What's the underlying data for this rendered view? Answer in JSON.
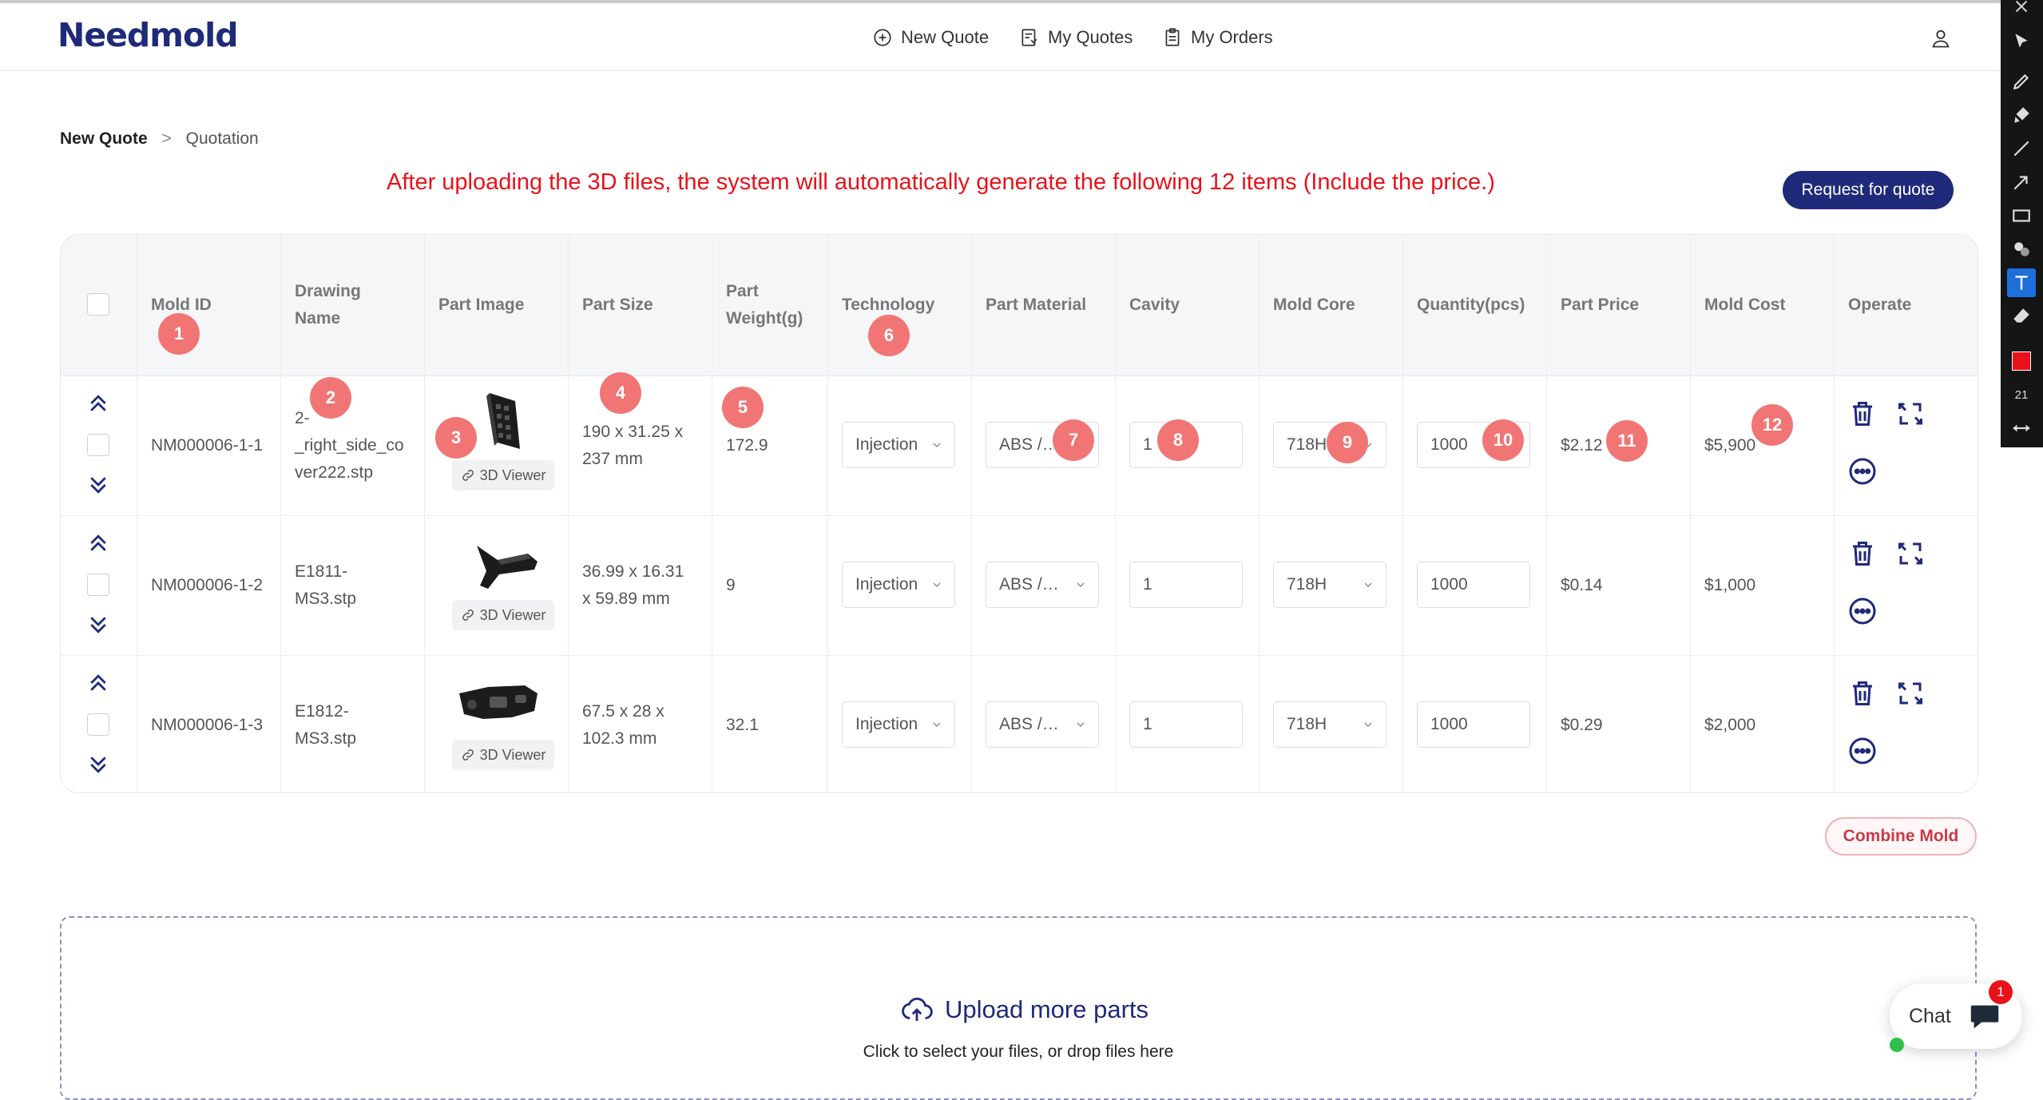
{
  "brand": {
    "logo_text": "Needmold",
    "accent": "#1f2a7a"
  },
  "nav": {
    "new_quote": "New Quote",
    "my_quotes": "My Quotes",
    "my_orders": "My Orders"
  },
  "breadcrumb": {
    "root": "New Quote",
    "separator": ">",
    "current": "Quotation"
  },
  "annotation_text": "After uploading the 3D files, the system will automatically generate the following 12 items (Include the price.)",
  "request_button": "Request for quote",
  "table": {
    "headers": {
      "mold_id": "Mold ID",
      "drawing_name_1": "Drawing",
      "drawing_name_2": "Name",
      "part_image": "Part Image",
      "part_size": "Part Size",
      "part_weight_1": "Part",
      "part_weight_2": "Weight(g)",
      "technology": "Technology",
      "part_material": "Part Material",
      "cavity": "Cavity",
      "mold_core": "Mold Core",
      "quantity": "Quantity(pcs)",
      "part_price": "Part Price",
      "mold_cost": "Mold Cost",
      "operate": "Operate"
    },
    "rows": [
      {
        "mold_id": "NM000006-1-1",
        "drawing_1": "2-",
        "drawing_2": "_right_side_co",
        "drawing_3": "ver222.stp",
        "size_1": "190 x 31.25 x",
        "size_2": "237 mm",
        "weight": "172.9",
        "technology": "Injection",
        "material": "ABS /…",
        "cavity": "1",
        "core": "718H",
        "quantity": "1000",
        "part_price": "$2.12",
        "mold_cost": "$5,900",
        "viewer": "3D Viewer"
      },
      {
        "mold_id": "NM000006-1-2",
        "drawing_1": "E1811-",
        "drawing_2": "MS3.stp",
        "drawing_3": "",
        "size_1": "36.99 x 16.31",
        "size_2": "x 59.89 mm",
        "weight": "9",
        "technology": "Injection",
        "material": "ABS /…",
        "cavity": "1",
        "core": "718H",
        "quantity": "1000",
        "part_price": "$0.14",
        "mold_cost": "$1,000",
        "viewer": "3D Viewer"
      },
      {
        "mold_id": "NM000006-1-3",
        "drawing_1": "E1812-",
        "drawing_2": "MS3.stp",
        "drawing_3": "",
        "size_1": "67.5 x 28 x",
        "size_2": "102.3 mm",
        "weight": "32.1",
        "technology": "Injection",
        "material": "ABS /…",
        "cavity": "1",
        "core": "718H",
        "quantity": "1000",
        "part_price": "$0.29",
        "mold_cost": "$2,000",
        "viewer": "3D Viewer"
      }
    ]
  },
  "markers": [
    "1",
    "2",
    "3",
    "4",
    "5",
    "6",
    "7",
    "8",
    "9",
    "10",
    "11",
    "12"
  ],
  "combine_button": "Combine Mold",
  "upload": {
    "title": "Upload more parts",
    "subtitle": "Click to select your files, or drop files here"
  },
  "chat": {
    "label": "Chat",
    "badge": "1"
  },
  "toolbar": {
    "size_label": "21",
    "active_color": "#e8121b"
  },
  "colors": {
    "annotation": "#e8121b",
    "marker": "#f17575",
    "combine_text": "#c73b45"
  }
}
